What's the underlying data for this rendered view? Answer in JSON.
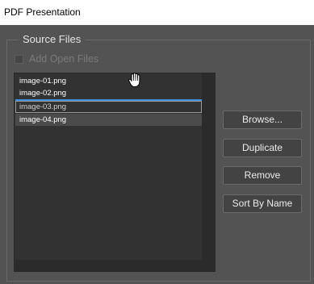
{
  "window": {
    "title": "PDF Presentation"
  },
  "source_files": {
    "group_label": "Source Files",
    "add_open_files_label": "Add Open Files",
    "add_open_files_checked": false,
    "items": [
      {
        "name": "image-01.png",
        "selected": false
      },
      {
        "name": "image-02.png",
        "selected": false
      },
      {
        "name": "image-03.png",
        "selected": false
      },
      {
        "name": "image-04.png",
        "selected": true
      }
    ]
  },
  "buttons": {
    "browse": "Browse...",
    "duplicate": "Duplicate",
    "remove": "Remove",
    "sort_by_name": "Sort By Name"
  },
  "colors": {
    "dialog_bg": "#535353",
    "list_bg": "#323232",
    "selection": "#4b4b4b",
    "insert_indicator": "#3c8fdc"
  },
  "cursor": "grab-hand-icon"
}
